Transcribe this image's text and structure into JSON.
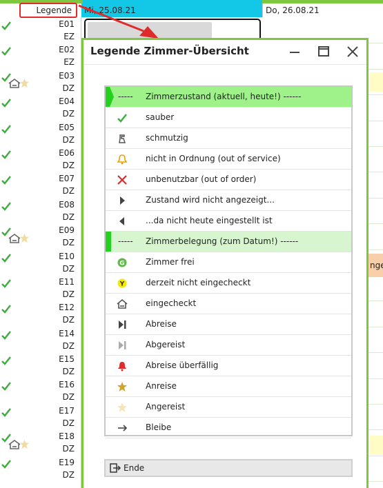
{
  "header": {
    "legend_button": "Legende",
    "date_col_1": "Mi, 25.08.21",
    "date_col_2": "Do, 26.08.21"
  },
  "rooms": [
    {
      "number": "E01",
      "type": "EZ",
      "occupied": false
    },
    {
      "number": "E02",
      "type": "EZ",
      "occupied": false
    },
    {
      "number": "E03",
      "type": "DZ",
      "occupied": true
    },
    {
      "number": "E04",
      "type": "DZ",
      "occupied": false
    },
    {
      "number": "E05",
      "type": "DZ",
      "occupied": false
    },
    {
      "number": "E06",
      "type": "DZ",
      "occupied": false
    },
    {
      "number": "E07",
      "type": "DZ",
      "occupied": false
    },
    {
      "number": "E08",
      "type": "DZ",
      "occupied": false
    },
    {
      "number": "E09",
      "type": "DZ",
      "occupied": true
    },
    {
      "number": "E10",
      "type": "DZ",
      "occupied": false
    },
    {
      "number": "E11",
      "type": "DZ",
      "occupied": false
    },
    {
      "number": "E12",
      "type": "DZ",
      "occupied": false
    },
    {
      "number": "E14",
      "type": "DZ",
      "occupied": false
    },
    {
      "number": "E15",
      "type": "DZ",
      "occupied": false
    },
    {
      "number": "E16",
      "type": "DZ",
      "occupied": false
    },
    {
      "number": "E17",
      "type": "DZ",
      "occupied": false
    },
    {
      "number": "E18",
      "type": "DZ",
      "occupied": true
    },
    {
      "number": "E19",
      "type": "DZ",
      "occupied": false
    }
  ],
  "calendar": {
    "peach_text": "nge"
  },
  "dialog": {
    "title": "Legende Zimmer-Übersicht",
    "section_1": {
      "dash": "-----",
      "label": "Zimmerzustand (aktuell, heute!) ------"
    },
    "section_2": {
      "dash": "-----",
      "label": "Zimmerbelegung (zum Datum!) ------"
    },
    "items_1": [
      {
        "icon": "check-icon",
        "label": "sauber"
      },
      {
        "icon": "broom-icon",
        "label": "schmutzig"
      },
      {
        "icon": "bell-outline-icon",
        "label": "nicht in Ordnung (out of service)"
      },
      {
        "icon": "x-icon",
        "label": "unbenutzbar (out of order)"
      },
      {
        "icon": "triangle-right-icon",
        "label": "Zustand wird nicht angezeigt..."
      },
      {
        "icon": "triangle-left-icon",
        "label": "...da nicht heute eingestellt ist"
      }
    ],
    "items_2": [
      {
        "icon": "g-circle-icon",
        "label": "Zimmer frei"
      },
      {
        "icon": "y-circle-icon",
        "label": "derzeit nicht eingecheckt"
      },
      {
        "icon": "house-icon",
        "label": "eingecheckt"
      },
      {
        "icon": "departure-icon",
        "label": "Abreise"
      },
      {
        "icon": "departed-icon",
        "label": "Abgereist"
      },
      {
        "icon": "bell-red-icon",
        "label": "Abreise überfällig"
      },
      {
        "icon": "star-icon",
        "label": "Anreise"
      },
      {
        "icon": "star-light-icon",
        "label": "Angereist"
      },
      {
        "icon": "arrow-right-icon",
        "label": "Bleibe"
      }
    ],
    "close_button": "Ende"
  },
  "colors": {
    "accent_green": "#7ec83f",
    "date_blue": "#13c7e6",
    "highlight_red": "#e02b2b"
  }
}
